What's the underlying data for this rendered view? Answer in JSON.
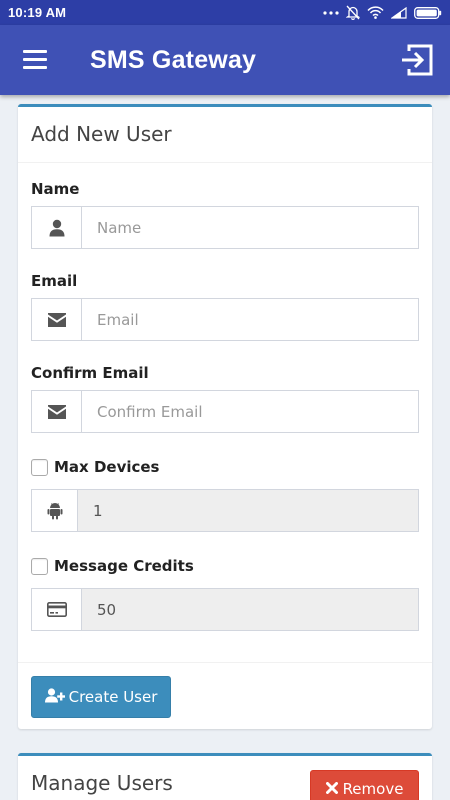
{
  "status_bar": {
    "time": "10:19 AM",
    "icons": [
      "more-dots-icon",
      "bell-off-icon",
      "wifi-icon",
      "signal-icon",
      "battery-icon"
    ]
  },
  "app_bar": {
    "title": "SMS Gateway",
    "menu_icon": "hamburger-menu-icon",
    "action_icon": "logout-icon"
  },
  "add_user": {
    "title": "Add New User",
    "name": {
      "label": "Name",
      "placeholder": "Name",
      "value": "",
      "icon": "user-icon"
    },
    "email": {
      "label": "Email",
      "placeholder": "Email",
      "value": "",
      "icon": "envelope-icon"
    },
    "confirm_email": {
      "label": "Confirm Email",
      "placeholder": "Confirm Email",
      "value": "",
      "icon": "envelope-icon"
    },
    "max_devices": {
      "label": "Max Devices",
      "checked": false,
      "value": "1",
      "icon": "android-icon"
    },
    "message_credits": {
      "label": "Message Credits",
      "checked": false,
      "value": "50",
      "icon": "credit-card-icon"
    },
    "create_button": "Create User"
  },
  "manage_users": {
    "title": "Manage Users",
    "remove_button": "Remove"
  },
  "colors": {
    "status_bar": "#2d3ea6",
    "app_bar": "#3f51b5",
    "primary": "#3c8dbc",
    "danger": "#dd4b39",
    "background": "#ecf0f5"
  }
}
